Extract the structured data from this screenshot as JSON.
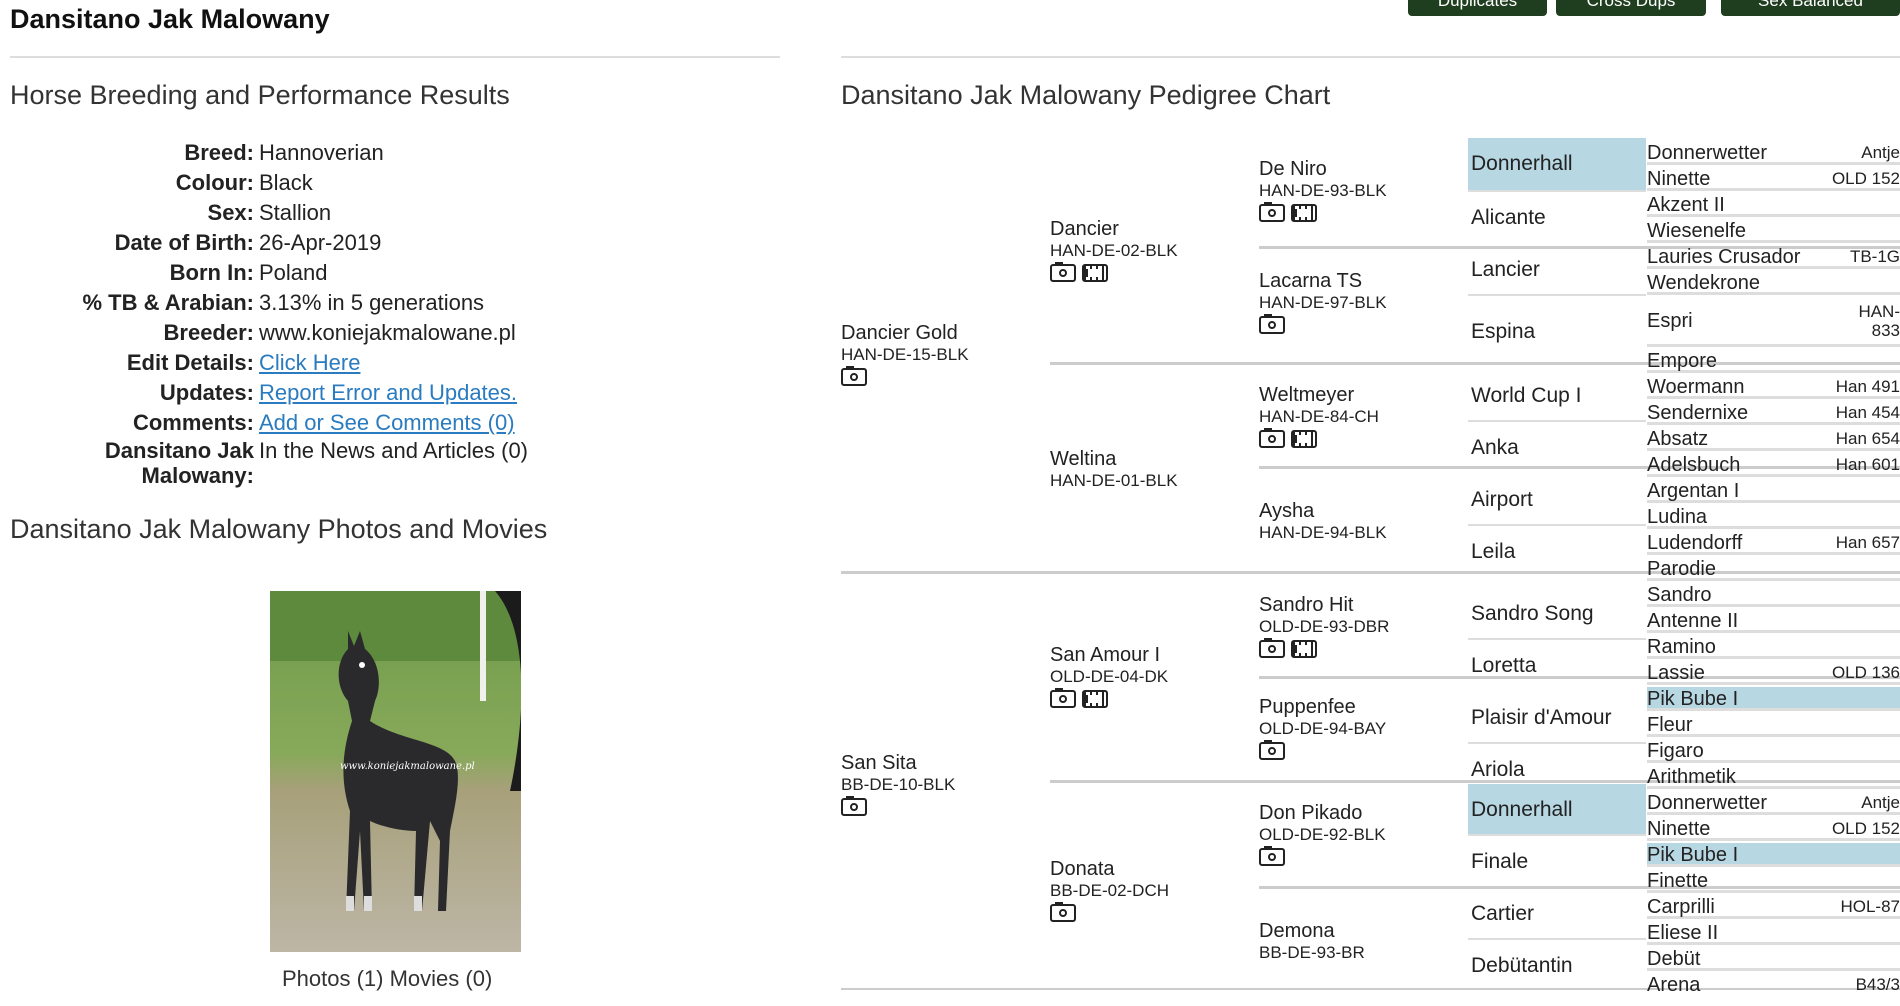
{
  "top_buttons": [
    "Duplicates",
    "Cross Dups",
    "Sex Balanced"
  ],
  "horse_name": "Dansitano Jak Malowany",
  "left": {
    "section_title": "Horse Breeding and Performance Results",
    "details": [
      {
        "label": "Breed:",
        "value": "Hannoverian"
      },
      {
        "label": "Colour:",
        "value": "Black"
      },
      {
        "label": "Sex:",
        "value": "Stallion"
      },
      {
        "label": "Date of Birth:",
        "value": "26-Apr-2019"
      },
      {
        "label": "Born In:",
        "value": "Poland"
      },
      {
        "label": "% TB & Arabian:",
        "value": "3.13% in 5 generations"
      },
      {
        "label": "Breeder:",
        "value": "www.koniejakmalowane.pl"
      }
    ],
    "links": [
      {
        "label": "Edit Details:",
        "value": "Click Here"
      },
      {
        "label": "Updates:",
        "value": "Report Error and Updates."
      },
      {
        "label": "Comments:",
        "value": "Add or See Comments (0)"
      }
    ],
    "news": {
      "label": "Dansitano Jak Malowany:",
      "value": "In the News and Articles (0)"
    },
    "photos_title": "Dansitano Jak Malowany Photos and Movies",
    "photo_caption": "Photos (1) Movies (0)",
    "watermark": "www.koniejakmalowane.pl"
  },
  "pedigree": {
    "title": "Dansitano Jak Malowany Pedigree Chart",
    "gen1": [
      {
        "name": "Dancier Gold",
        "reg": "HAN-DE-15-BLK"
      },
      {
        "name": "San Sita",
        "reg": "BB-DE-10-BLK"
      }
    ],
    "gen2": [
      {
        "name": "Dancier",
        "reg": "HAN-DE-02-BLK"
      },
      {
        "name": "Weltina",
        "reg": "HAN-DE-01-BLK"
      },
      {
        "name": "San Amour I",
        "reg": "OLD-DE-04-DK"
      },
      {
        "name": "Donata",
        "reg": "BB-DE-02-DCH"
      }
    ],
    "gen3": [
      {
        "name": "De Niro",
        "reg": "HAN-DE-93-BLK"
      },
      {
        "name": "Lacarna TS",
        "reg": "HAN-DE-97-BLK"
      },
      {
        "name": "Weltmeyer",
        "reg": "HAN-DE-84-CH"
      },
      {
        "name": "Aysha",
        "reg": "HAN-DE-94-BLK"
      },
      {
        "name": "Sandro Hit",
        "reg": "OLD-DE-93-DBR"
      },
      {
        "name": "Puppenfee",
        "reg": "OLD-DE-94-BAY"
      },
      {
        "name": "Don Pikado",
        "reg": "OLD-DE-92-BLK"
      },
      {
        "name": "Demona",
        "reg": "BB-DE-93-BR"
      }
    ],
    "gen4": [
      "Donnerhall",
      "Alicante",
      "Lancier",
      "Espina",
      "World Cup I",
      "Anka",
      "Airport",
      "Leila",
      "Sandro Song",
      "Loretta",
      "Plaisir d'Amour",
      "Ariola",
      "Donnerhall",
      "Finale",
      "Cartier",
      "Debütantin"
    ],
    "gen5": [
      {
        "name": "Donnerwetter",
        "reg": "Antje"
      },
      {
        "name": "Ninette",
        "reg": "OLD 152"
      },
      {
        "name": "Akzent II",
        "reg": ""
      },
      {
        "name": "Wiesenelfe",
        "reg": ""
      },
      {
        "name": "Lauries Crusador",
        "reg": "TB-1G"
      },
      {
        "name": "Wendekrone",
        "reg": ""
      },
      {
        "name": "Espri",
        "reg": "HAN-833"
      },
      {
        "name": "Empore",
        "reg": ""
      },
      {
        "name": "Woermann",
        "reg": "Han 491"
      },
      {
        "name": "Sendernixe",
        "reg": "Han 454"
      },
      {
        "name": "Absatz",
        "reg": "Han 654"
      },
      {
        "name": "Adelsbuch",
        "reg": "Han 601"
      },
      {
        "name": "Argentan I",
        "reg": ""
      },
      {
        "name": "Ludina",
        "reg": ""
      },
      {
        "name": "Ludendorff",
        "reg": "Han 657"
      },
      {
        "name": "Parodie",
        "reg": ""
      },
      {
        "name": "Sandro",
        "reg": ""
      },
      {
        "name": "Antenne II",
        "reg": ""
      },
      {
        "name": "Ramino",
        "reg": ""
      },
      {
        "name": "Lassie",
        "reg": "OLD 136"
      },
      {
        "name": "Pik Bube I",
        "reg": ""
      },
      {
        "name": "Fleur",
        "reg": ""
      },
      {
        "name": "Figaro",
        "reg": ""
      },
      {
        "name": "Arithmetik",
        "reg": ""
      },
      {
        "name": "Donnerwetter",
        "reg": "Antje"
      },
      {
        "name": "Ninette",
        "reg": "OLD 152"
      },
      {
        "name": "Pik Bube I",
        "reg": ""
      },
      {
        "name": "Finette",
        "reg": ""
      },
      {
        "name": "Carprilli",
        "reg": "HOL-87"
      },
      {
        "name": "Eliese II",
        "reg": ""
      },
      {
        "name": "Debüt",
        "reg": ""
      },
      {
        "name": "Arena",
        "reg": "B43/3"
      }
    ]
  }
}
